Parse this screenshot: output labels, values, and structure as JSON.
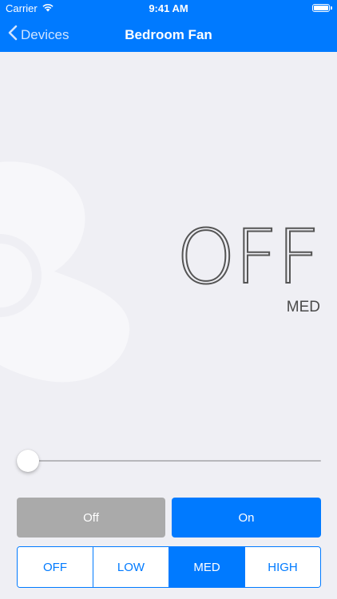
{
  "status_bar": {
    "carrier": "Carrier",
    "time": "9:41 AM",
    "battery_level": 1.0
  },
  "nav": {
    "back_label": "Devices",
    "title": "Bedroom Fan"
  },
  "fan": {
    "state": "OFF",
    "speed": "MED"
  },
  "slider": {
    "value": 0.0
  },
  "power_buttons": {
    "off_label": "Off",
    "on_label": "On"
  },
  "speed_segments": {
    "items": [
      "OFF",
      "LOW",
      "MED",
      "HIGH"
    ],
    "selected_index": 2
  },
  "colors": {
    "accent": "#007aff",
    "background": "#efeff4",
    "off_button": "#aaaaaa",
    "fan_graphic": "#f7f7fa",
    "text_dark": "#4a4a4a"
  }
}
